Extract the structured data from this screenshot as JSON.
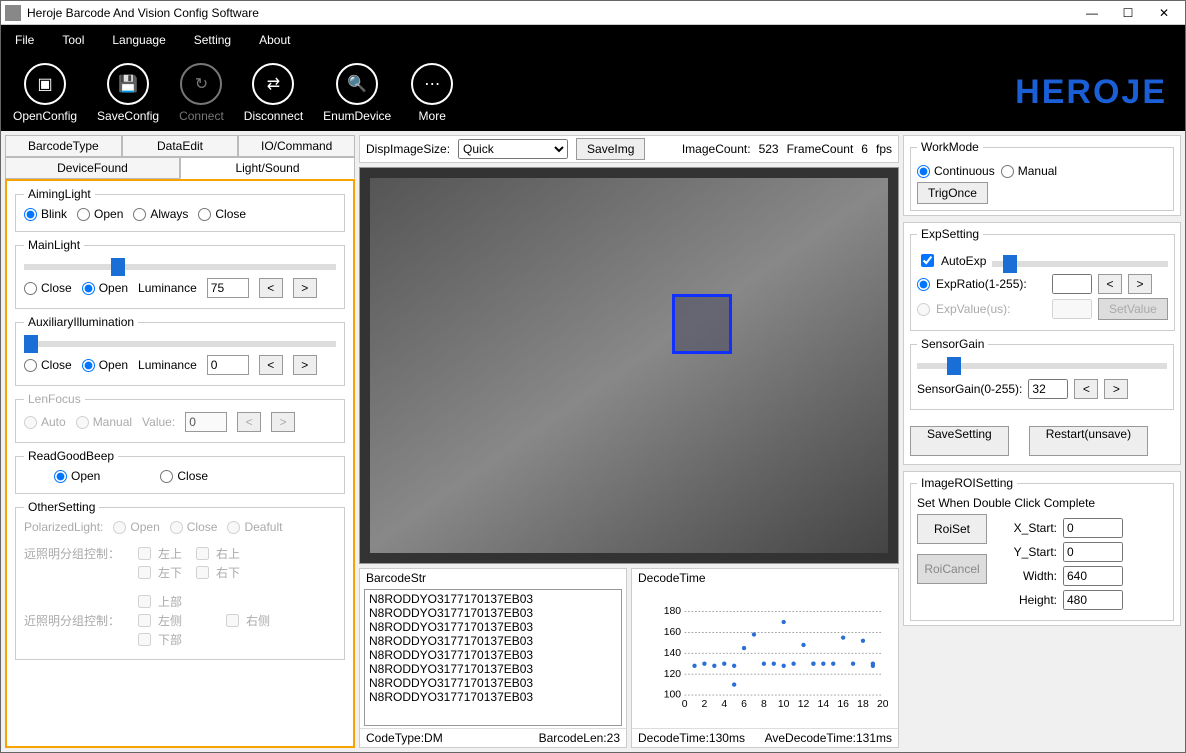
{
  "window": {
    "title": "Heroje Barcode And Vision Config Software"
  },
  "menu": {
    "file": "File",
    "tool": "Tool",
    "language": "Language",
    "setting": "Setting",
    "about": "About"
  },
  "toolbar": {
    "open": "OpenConfig",
    "save": "SaveConfig",
    "connect": "Connect",
    "disconnect": "Disconnect",
    "enum": "EnumDevice",
    "more": "More",
    "brand": "HEROJE"
  },
  "tabs": {
    "barcodetype": "BarcodeType",
    "dataedit": "DataEdit",
    "iocommand": "IO/Command",
    "devicefound": "DeviceFound",
    "lightsound": "Light/Sound"
  },
  "aiming": {
    "legend": "AimingLight",
    "blink": "Blink",
    "open": "Open",
    "always": "Always",
    "close": "Close"
  },
  "mainlight": {
    "legend": "MainLight",
    "close": "Close",
    "open": "Open",
    "lumlabel": "Luminance",
    "lumval": "75"
  },
  "auxlight": {
    "legend": "AuxiliaryIllumination",
    "close": "Close",
    "open": "Open",
    "lumlabel": "Luminance",
    "lumval": "0"
  },
  "lenfocus": {
    "legend": "LenFocus",
    "auto": "Auto",
    "manual": "Manual",
    "valuelabel": "Value:",
    "value": "0"
  },
  "beep": {
    "legend": "ReadGoodBeep",
    "open": "Open",
    "close": "Close"
  },
  "other": {
    "legend": "OtherSetting",
    "pol_label": "PolarizedLight:",
    "pol_open": "Open",
    "pol_close": "Close",
    "pol_default": "Deafult",
    "far_label": "远照明分组控制：",
    "lu": "左上",
    "ru": "右上",
    "ld": "左下",
    "rd": "右下",
    "near_label": "近照明分组控制：",
    "top": "上部",
    "left": "左侧",
    "right": "右侧",
    "bottom": "下部"
  },
  "imgbar": {
    "dispsize": "DispImageSize:",
    "quick": "Quick",
    "saveimg": "SaveImg",
    "imgcount_label": "ImageCount:",
    "imgcount": "523",
    "framecount_label": "FrameCount",
    "framecount": "6",
    "fps": "fps"
  },
  "barcodestr": {
    "title": "BarcodeStr",
    "lines": [
      "N8RODDYO3177170137EB03",
      "N8RODDYO3177170137EB03",
      "N8RODDYO3177170137EB03",
      "N8RODDYO3177170137EB03",
      "N8RODDYO3177170137EB03",
      "N8RODDYO3177170137EB03",
      "N8RODDYO3177170137EB03",
      "N8RODDYO3177170137EB03"
    ],
    "codetype_label": "CodeType:",
    "codetype": "DM",
    "len_label": "BarcodeLen:",
    "len": "23"
  },
  "decode": {
    "title": "DecodeTime",
    "foot_time_label": "DecodeTime:",
    "foot_time": "130ms",
    "foot_ave_label": "AveDecodeTime:",
    "foot_ave": "131ms"
  },
  "workmode": {
    "legend": "WorkMode",
    "continuous": "Continuous",
    "manual": "Manual",
    "trigonce": "TrigOnce"
  },
  "expsetting": {
    "legend": "ExpSetting",
    "autoexp": "AutoExp",
    "ratio_label": "ExpRatio(1-255):",
    "ratio_val": "",
    "value_label": "ExpValue(us):",
    "value_val": "",
    "setvalue": "SetValue"
  },
  "sensorgain": {
    "legend": "SensorGain",
    "label": "SensorGain(0-255):",
    "value": "32"
  },
  "actions": {
    "save": "SaveSetting",
    "restart": "Restart(unsave)"
  },
  "roi": {
    "legend": "ImageROISetting",
    "hint": "Set When Double Click Complete",
    "roiset": "RoiSet",
    "roicancel": "RoiCancel",
    "xstart_label": "X_Start:",
    "xstart": "0",
    "ystart_label": "Y_Start:",
    "ystart": "0",
    "width_label": "Width:",
    "width": "640",
    "height_label": "Height:",
    "height": "480"
  },
  "chart_data": {
    "type": "scatter",
    "title": "DecodeTime",
    "xlabel": "",
    "ylabel": "",
    "xlim": [
      0,
      20
    ],
    "ylim": [
      100,
      180
    ],
    "xticks": [
      0,
      2,
      4,
      6,
      8,
      10,
      12,
      14,
      16,
      18,
      20
    ],
    "yticks": [
      100,
      120,
      140,
      160,
      180
    ],
    "x": [
      1,
      2,
      3,
      4,
      5,
      5,
      6,
      7,
      8,
      9,
      10,
      10,
      11,
      12,
      13,
      13,
      14,
      15,
      16,
      17,
      18,
      19,
      19
    ],
    "y": [
      128,
      130,
      128,
      130,
      128,
      110,
      145,
      158,
      130,
      130,
      128,
      170,
      130,
      148,
      130,
      130,
      130,
      130,
      155,
      130,
      152,
      130,
      128
    ]
  }
}
